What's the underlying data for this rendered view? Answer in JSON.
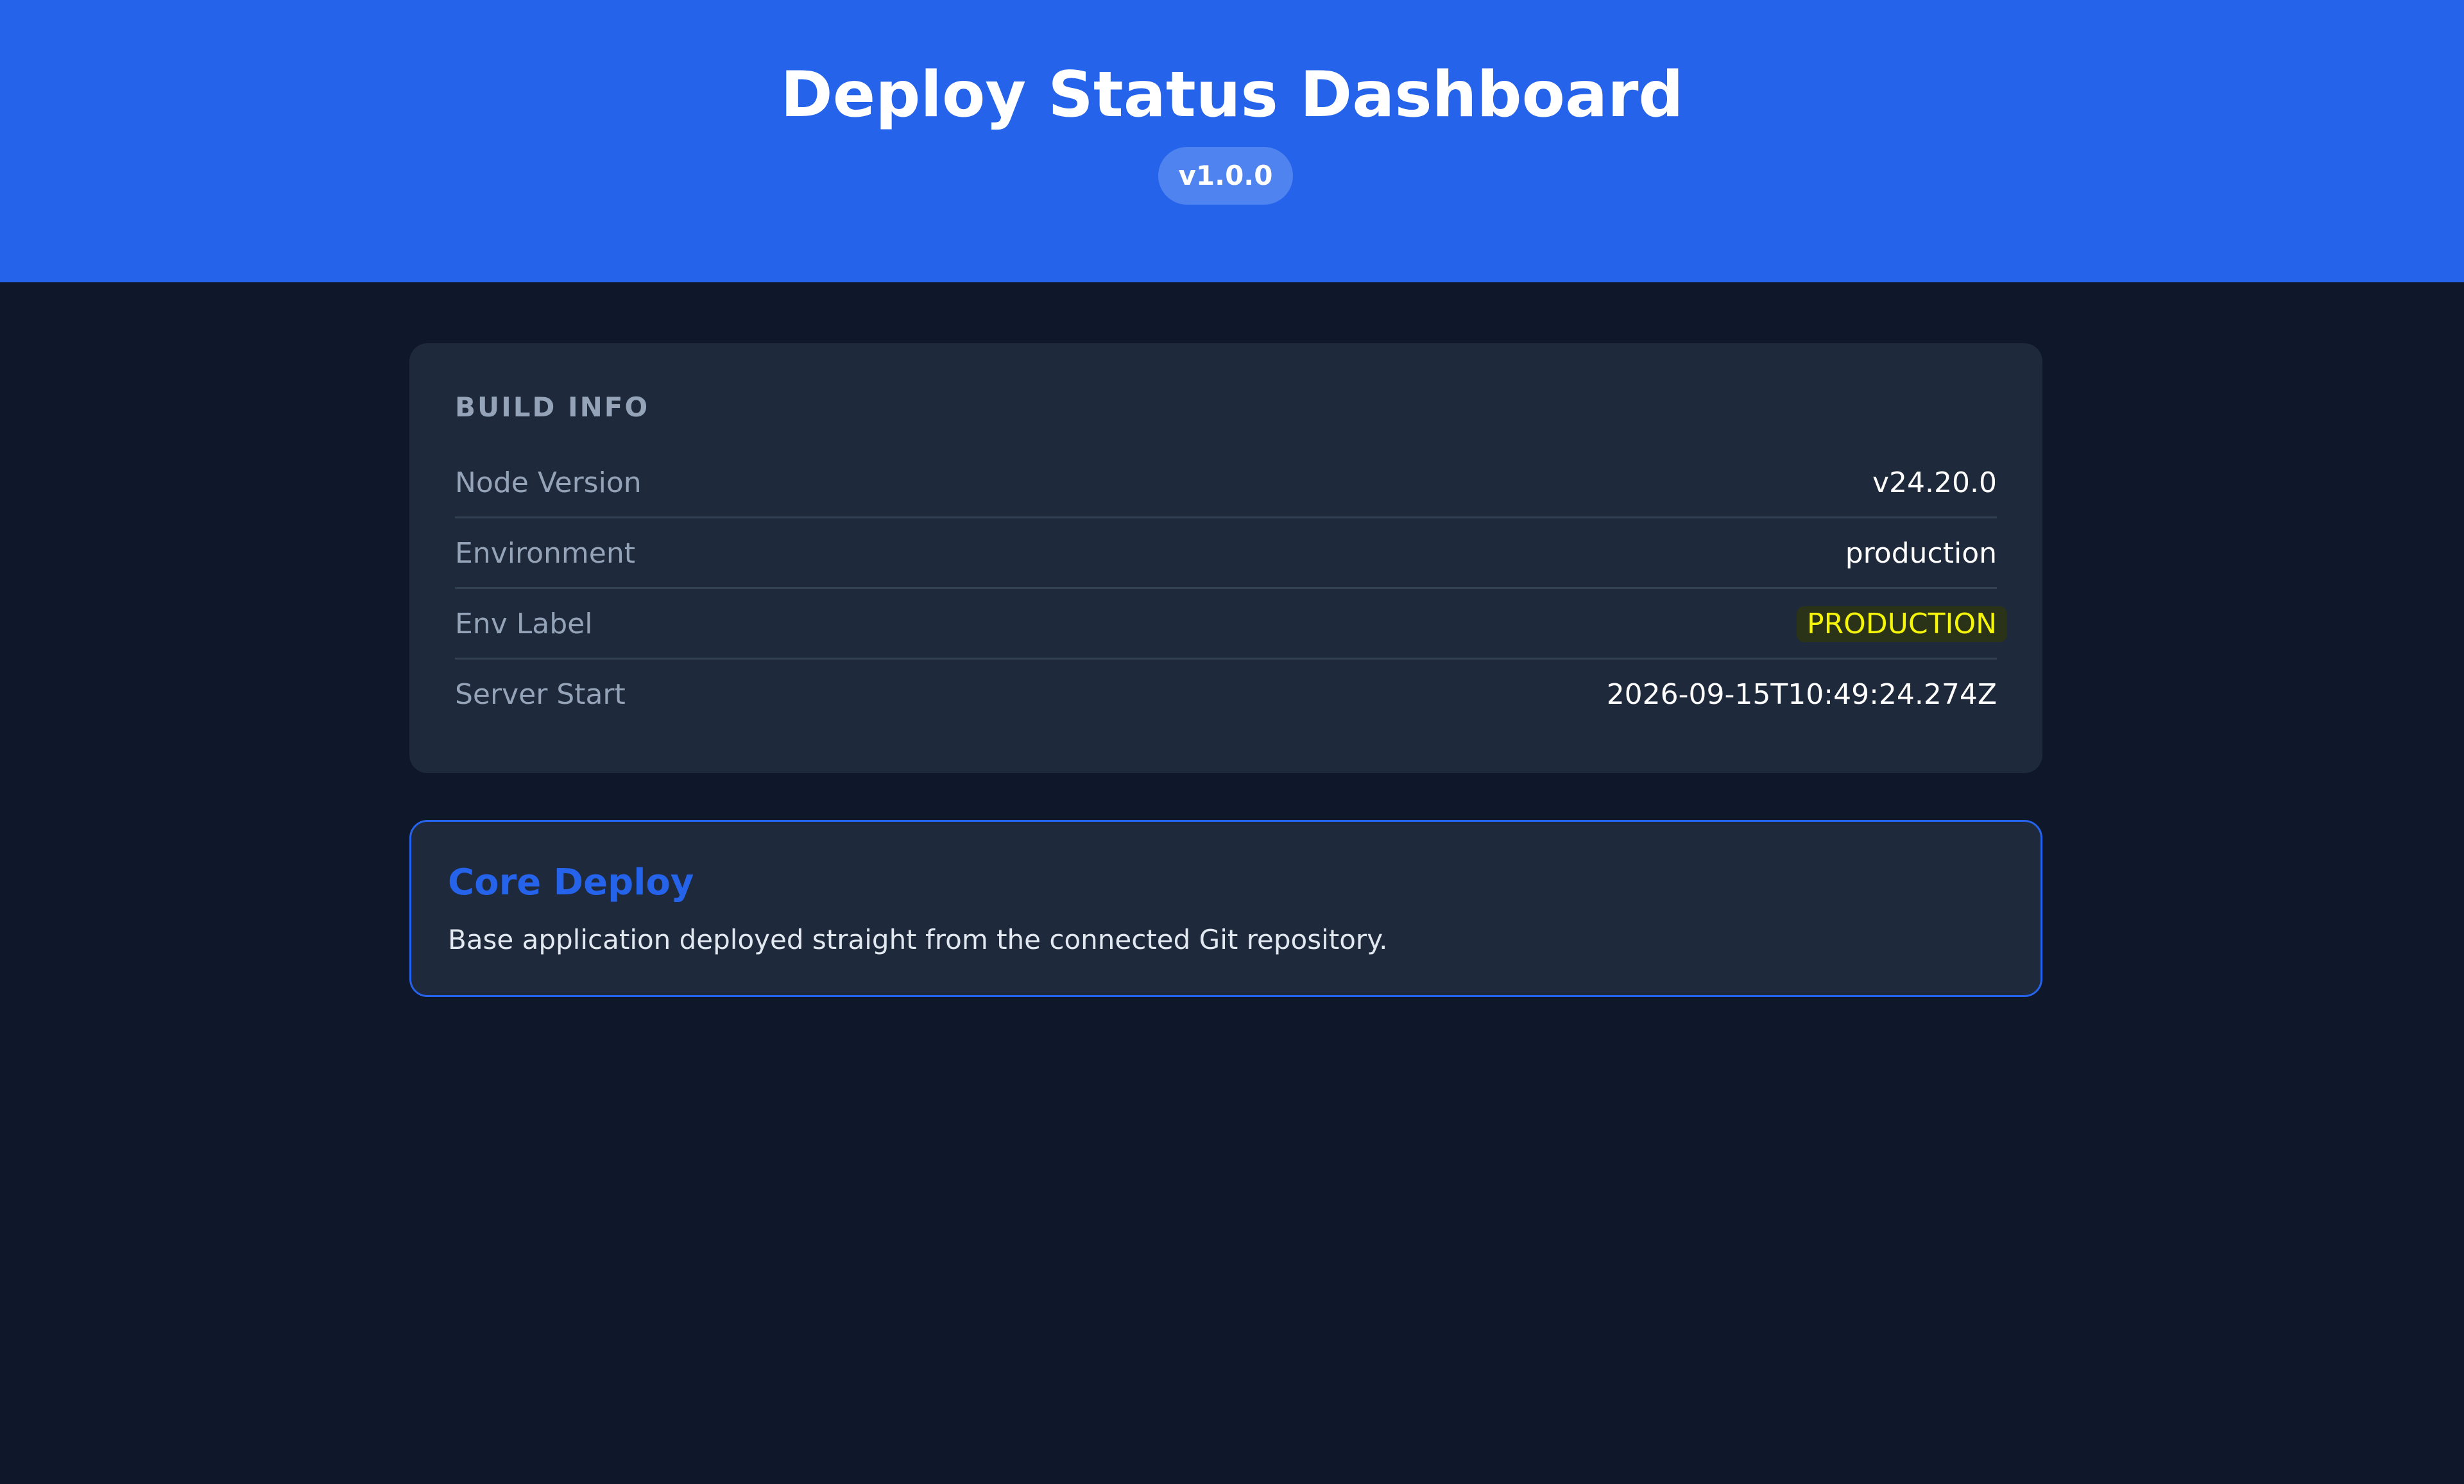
{
  "header": {
    "title": "Deploy Status Dashboard",
    "version": "v1.0.0"
  },
  "build_info": {
    "heading": "BUILD INFO",
    "rows": [
      {
        "label": "Node Version",
        "value": "v24.20.0"
      },
      {
        "label": "Environment",
        "value": "production"
      },
      {
        "label": "Env Label",
        "value": "PRODUCTION"
      },
      {
        "label": "Server Start",
        "value": "2026-09-15T10:49:24.274Z"
      }
    ]
  },
  "core_deploy": {
    "title": "Core Deploy",
    "description": "Base application deployed straight from the connected Git repository."
  },
  "colors": {
    "header_bg": "#2563eb",
    "page_bg": "#0f172a",
    "card_bg": "#1e293b",
    "accent": "#2563eb",
    "env_label_text": "#f5f50a"
  }
}
